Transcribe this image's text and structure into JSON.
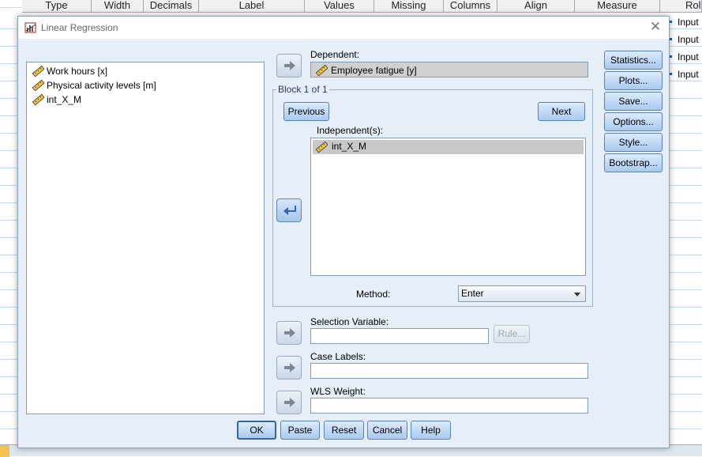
{
  "editor": {
    "columns": [
      "Type",
      "Width",
      "Decimals",
      "Label",
      "Values",
      "Missing",
      "Columns",
      "Align",
      "Measure",
      "Role"
    ],
    "role_values": [
      "Input",
      "Input",
      "Input",
      "Input"
    ]
  },
  "dialog": {
    "title": "Linear Regression",
    "close_icon": "close-icon",
    "variables": [
      {
        "label": "Work hours [x]",
        "icon": "scale-ruler-icon"
      },
      {
        "label": "Physical activity levels [m]",
        "icon": "scale-ruler-icon"
      },
      {
        "label": "int_X_M",
        "icon": "scale-ruler-icon"
      }
    ],
    "dependent": {
      "label": "Dependent:",
      "value": "Employee fatigue [y]"
    },
    "block": {
      "label": "Block 1 of 1",
      "previous": "Previous",
      "next": "Next"
    },
    "independents": {
      "label": "Independent(s):",
      "items": [
        "int_X_M"
      ]
    },
    "method": {
      "label": "Method:",
      "value": "Enter"
    },
    "selection_variable": {
      "label": "Selection Variable:",
      "value": "",
      "rule_button": "Rule..."
    },
    "case_labels": {
      "label": "Case Labels:",
      "value": ""
    },
    "wls_weight": {
      "label": "WLS Weight:",
      "value": ""
    },
    "side_buttons": [
      "Statistics...",
      "Plots...",
      "Save...",
      "Options...",
      "Style...",
      "Bootstrap..."
    ],
    "bottom_buttons": [
      "OK",
      "Paste",
      "Reset",
      "Cancel",
      "Help"
    ]
  }
}
